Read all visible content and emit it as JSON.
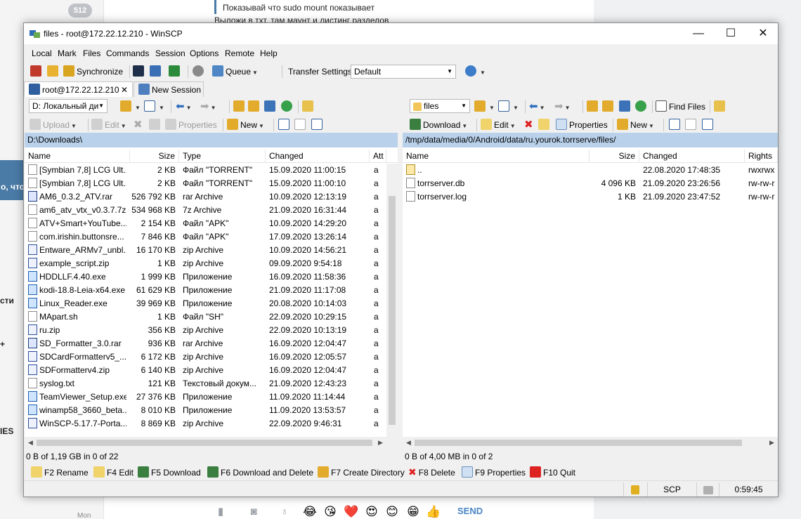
{
  "background": {
    "badge": "512",
    "chat_fragment": "о, что",
    "side_fragments": [
      "сти",
      "+",
      "IES"
    ],
    "day_label": "Mon",
    "quote_line": "Показывай что sudo mount показывает",
    "quote_line2": "Выложи в тхт, там маунт и листинг разделов",
    "send_label": "SEND"
  },
  "window": {
    "title": "files - root@172.22.12.210 - WinSCP"
  },
  "menu": [
    "Local",
    "Mark",
    "Files",
    "Commands",
    "Session",
    "Options",
    "Remote",
    "Help"
  ],
  "toolbar": {
    "synchronize": "Synchronize",
    "queue": "Queue",
    "transfer_settings": "Transfer Settings",
    "transfer_value": "Default"
  },
  "tabs": {
    "session": "root@172.22.12.210",
    "new_session": "New Session"
  },
  "left": {
    "drive": "D: Локальный ди",
    "upload": "Upload",
    "edit": "Edit",
    "properties": "Properties",
    "new": "New",
    "path": "D:\\Downloads\\",
    "headers": [
      "Name",
      "Size",
      "Type",
      "Changed",
      "Att"
    ],
    "rows": [
      {
        "name": "[Symbian 7,8] LCG Ult...",
        "size": "2 KB",
        "type": "Файл \"TORRENT\"",
        "changed": "15.09.2020  11:00:15",
        "attr": "a",
        "icon": "file"
      },
      {
        "name": "[Symbian 7,8] LCG Ult...",
        "size": "2 KB",
        "type": "Файл \"TORRENT\"",
        "changed": "15.09.2020  11:00:10",
        "attr": "a",
        "icon": "file"
      },
      {
        "name": "AM6_0.3.2_ATV.rar",
        "size": "526 792 KB",
        "type": "rar Archive",
        "changed": "10.09.2020  12:13:19",
        "attr": "a",
        "icon": "rar"
      },
      {
        "name": "am6_atv_vtx_v0.3.7.7z",
        "size": "534 968 KB",
        "type": "7z Archive",
        "changed": "21.09.2020  16:31:44",
        "attr": "a",
        "icon": "file"
      },
      {
        "name": "ATV+Smart+YouTube...",
        "size": "2 154 KB",
        "type": "Файл \"APK\"",
        "changed": "10.09.2020  14:29:20",
        "attr": "a",
        "icon": "file"
      },
      {
        "name": "com.irishin.buttonsre...",
        "size": "7 846 KB",
        "type": "Файл \"APK\"",
        "changed": "17.09.2020  13:26:14",
        "attr": "a",
        "icon": "file"
      },
      {
        "name": "Entware_ARMv7_unbl...",
        "size": "16 170 KB",
        "type": "zip Archive",
        "changed": "10.09.2020  14:56:21",
        "attr": "a",
        "icon": "zip"
      },
      {
        "name": "example_script.zip",
        "size": "1 KB",
        "type": "zip Archive",
        "changed": "09.09.2020  9:54:18",
        "attr": "a",
        "icon": "zip"
      },
      {
        "name": "HDDLLF.4.40.exe",
        "size": "1 999 KB",
        "type": "Приложение",
        "changed": "16.09.2020  11:58:36",
        "attr": "a",
        "icon": "exe"
      },
      {
        "name": "kodi-18.8-Leia-x64.exe",
        "size": "61 629 KB",
        "type": "Приложение",
        "changed": "21.09.2020  11:17:08",
        "attr": "a",
        "icon": "exe"
      },
      {
        "name": "Linux_Reader.exe",
        "size": "39 969 KB",
        "type": "Приложение",
        "changed": "20.08.2020  10:14:03",
        "attr": "a",
        "icon": "exe"
      },
      {
        "name": "MApart.sh",
        "size": "1 KB",
        "type": "Файл \"SH\"",
        "changed": "22.09.2020  10:29:15",
        "attr": "a",
        "icon": "file"
      },
      {
        "name": "ru.zip",
        "size": "356 KB",
        "type": "zip Archive",
        "changed": "22.09.2020  10:13:19",
        "attr": "a",
        "icon": "zip"
      },
      {
        "name": "SD_Formatter_3.0.rar",
        "size": "936 KB",
        "type": "rar Archive",
        "changed": "16.09.2020  12:04:47",
        "attr": "a",
        "icon": "rar"
      },
      {
        "name": "SDCardFormatterv5_...",
        "size": "6 172 KB",
        "type": "zip Archive",
        "changed": "16.09.2020  12:05:57",
        "attr": "a",
        "icon": "zip"
      },
      {
        "name": "SDFormatterv4.zip",
        "size": "6 140 KB",
        "type": "zip Archive",
        "changed": "16.09.2020  12:04:47",
        "attr": "a",
        "icon": "zip"
      },
      {
        "name": "syslog.txt",
        "size": "121 KB",
        "type": "Текстовый докум...",
        "changed": "21.09.2020  12:43:23",
        "attr": "a",
        "icon": "file"
      },
      {
        "name": "TeamViewer_Setup.exe",
        "size": "27 376 KB",
        "type": "Приложение",
        "changed": "11.09.2020  11:14:44",
        "attr": "a",
        "icon": "exe"
      },
      {
        "name": "winamp58_3660_beta...",
        "size": "8 010 KB",
        "type": "Приложение",
        "changed": "11.09.2020  13:53:57",
        "attr": "a",
        "icon": "exe"
      },
      {
        "name": "WinSCP-5.17.7-Porta...",
        "size": "8 869 KB",
        "type": "zip Archive",
        "changed": "22.09.2020  9:46:31",
        "attr": "a",
        "icon": "zip"
      }
    ],
    "status": "0 B of 1,19 GB in 0 of 22"
  },
  "right": {
    "folder": "files",
    "find_files": "Find Files",
    "download": "Download",
    "edit": "Edit",
    "properties": "Properties",
    "new": "New",
    "path": "/tmp/data/media/0/Android/data/ru.yourok.torrserve/files/",
    "headers": [
      "Name",
      "Size",
      "Changed",
      "Rights"
    ],
    "rows": [
      {
        "name": "..",
        "size": "",
        "changed": "22.08.2020 17:48:35",
        "rights": "rwxrwx",
        "icon": "up"
      },
      {
        "name": "torrserver.db",
        "size": "4 096 KB",
        "changed": "21.09.2020 23:26:56",
        "rights": "rw-rw-r",
        "icon": "file"
      },
      {
        "name": "torrserver.log",
        "size": "1 KB",
        "changed": "21.09.2020 23:47:52",
        "rights": "rw-rw-r",
        "icon": "file"
      }
    ],
    "status": "0 B of 4,00 MB in 0 of 2"
  },
  "fkeys": [
    "F2 Rename",
    "F4 Edit",
    "F5 Download",
    "F6 Download and Delete",
    "F7 Create Directory",
    "F8 Delete",
    "F9 Properties",
    "F10 Quit"
  ],
  "statusbar": {
    "protocol": "SCP",
    "time": "0:59:45"
  }
}
